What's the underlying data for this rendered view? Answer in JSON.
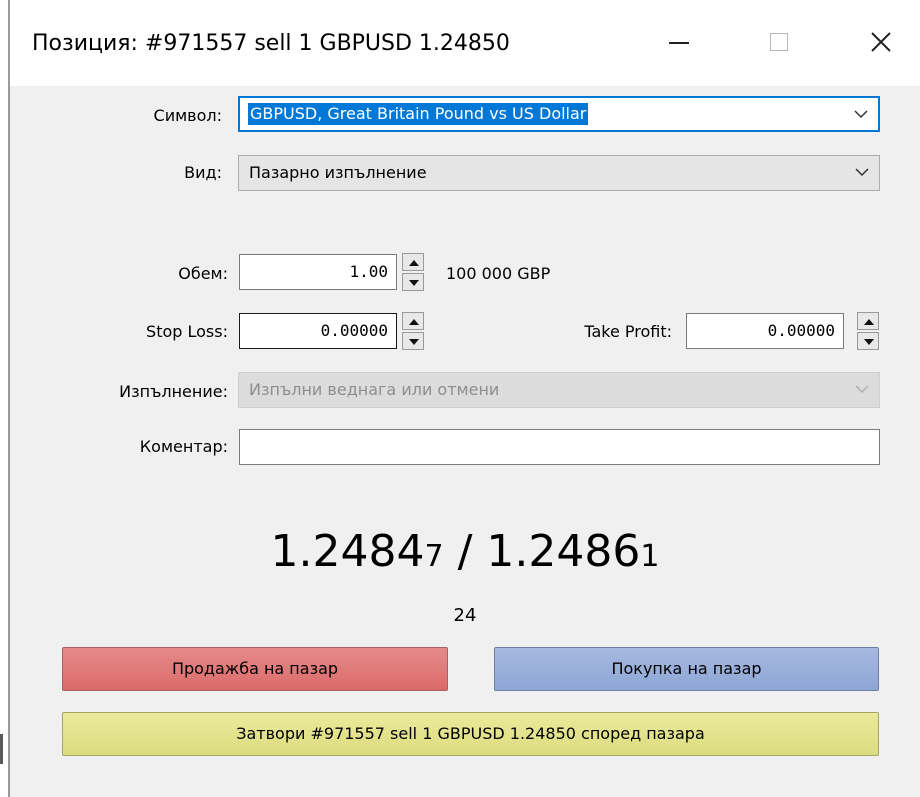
{
  "window": {
    "title": "Позиция: #971557 sell 1 GBPUSD 1.24850"
  },
  "form": {
    "symbol": {
      "label": "Символ:",
      "value": "GBPUSD, Great Britain Pound vs US Dollar"
    },
    "type": {
      "label": "Вид:",
      "value": "Пазарно изпълнение"
    },
    "volume": {
      "label": "Обем:",
      "value": "1.00",
      "note": "100 000 GBP"
    },
    "stop_loss": {
      "label": "Stop Loss:",
      "value": "0.00000"
    },
    "take_profit": {
      "label": "Take Profit:",
      "value": "0.00000"
    },
    "execution": {
      "label": "Изпълнение:",
      "value": "Изпълни веднага или отмени"
    },
    "comment": {
      "label": "Коментар:",
      "value": ""
    }
  },
  "quote": {
    "bid_main": "1.2484",
    "bid_last": "7",
    "separator": " / ",
    "ask_main": "1.2486",
    "ask_last": "1",
    "spread": "24"
  },
  "actions": {
    "sell_label": "Продажба на пазар",
    "buy_label": "Покупка на пазар",
    "close_label": "Затвори #971557 sell 1 GBPUSD 1.24850 според пазара"
  },
  "colors": {
    "sell": "#dc6a6a",
    "buy": "#8ea6d6",
    "close": "#dcdc80",
    "focus": "#0078d7"
  }
}
